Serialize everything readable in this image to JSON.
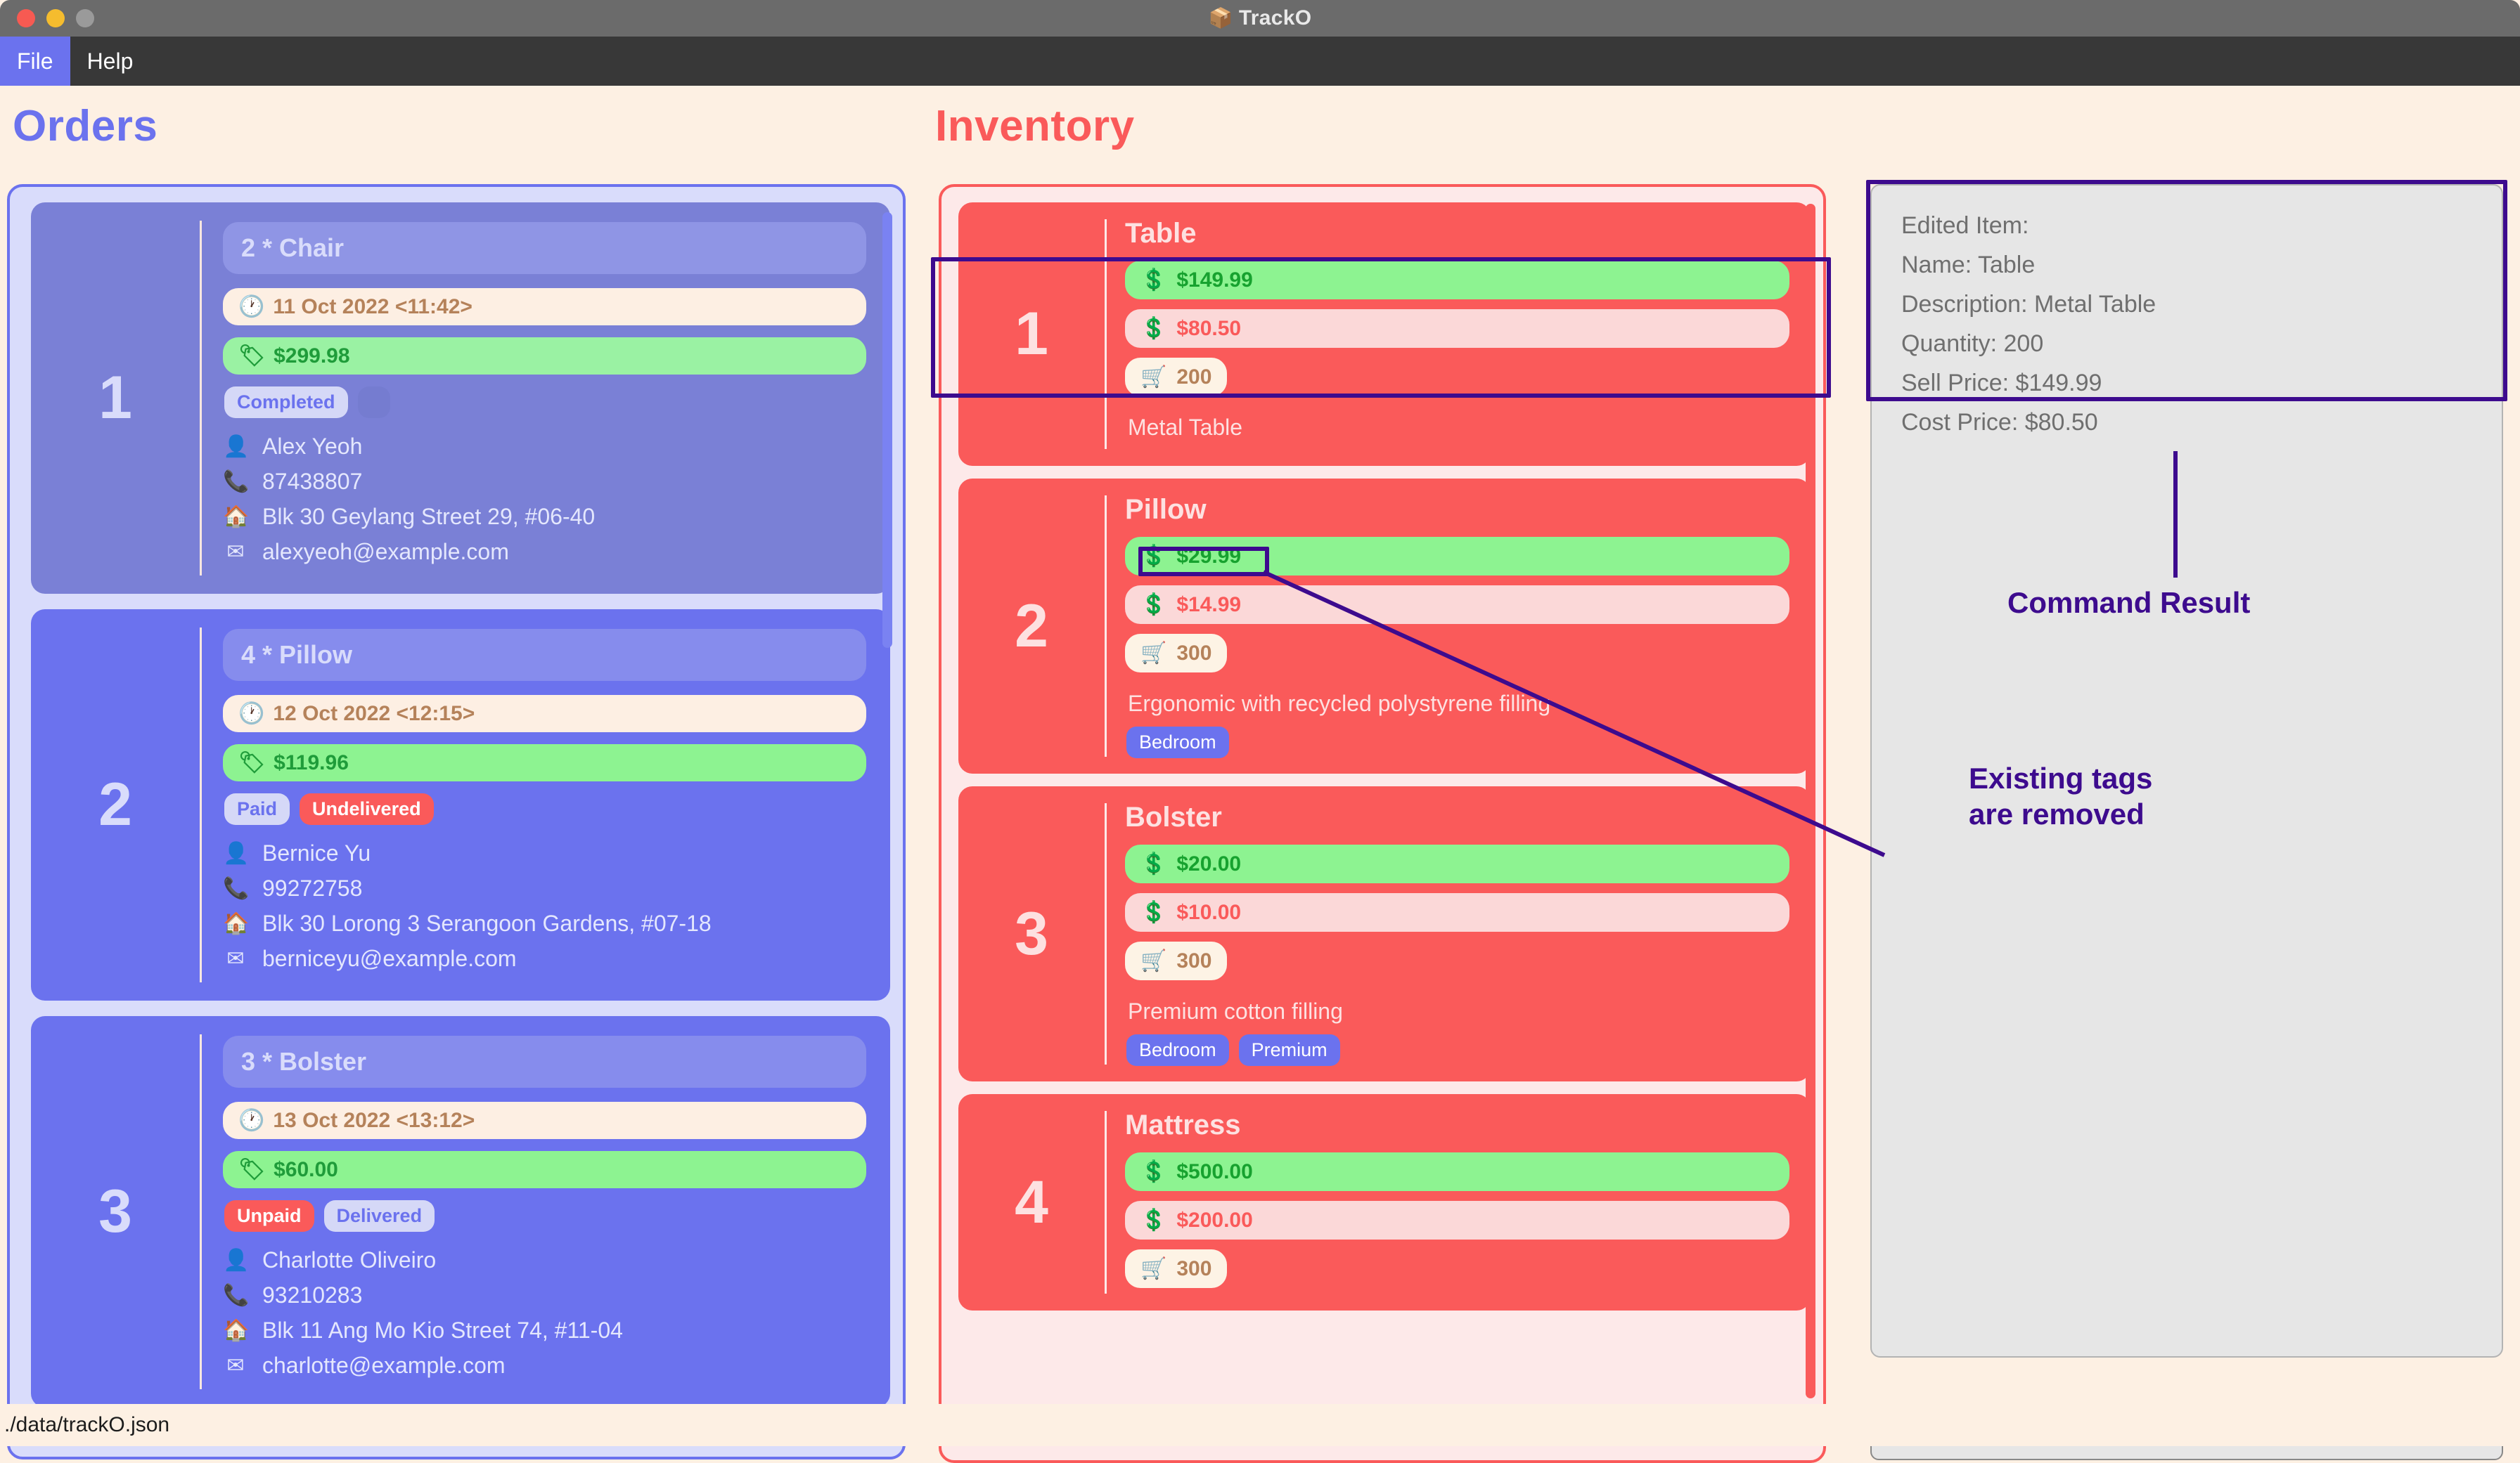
{
  "window": {
    "title": "TrackO",
    "title_icon": "package-icon",
    "traffic_lights": [
      "close",
      "minimize",
      "maximize"
    ]
  },
  "menubar": {
    "items": [
      {
        "label": "File",
        "active": true
      },
      {
        "label": "Help",
        "active": false
      }
    ]
  },
  "orders": {
    "heading": "Orders",
    "accent": "#6b72ee",
    "cards": [
      {
        "index": "1",
        "title": "2 * Chair",
        "date": "11 Oct 2022 <11:42>",
        "price": "$299.98",
        "badges": [
          {
            "label": "Completed",
            "style": "neutral"
          },
          {
            "label": "",
            "style": "ghost"
          }
        ],
        "name": "Alex Yeoh",
        "phone": "87438807",
        "address": "Blk 30 Geylang Street 29, #06-40",
        "email": "alexyeoh@example.com"
      },
      {
        "index": "2",
        "title": "4 * Pillow",
        "date": "12 Oct 2022 <12:15>",
        "price": "$119.96",
        "badges": [
          {
            "label": "Paid",
            "style": "neutral"
          },
          {
            "label": "Undelivered",
            "style": "alert"
          }
        ],
        "name": "Bernice Yu",
        "phone": "99272758",
        "address": "Blk 30 Lorong 3 Serangoon Gardens, #07-18",
        "email": "berniceyu@example.com"
      },
      {
        "index": "3",
        "title": "3 * Bolster",
        "date": "13 Oct 2022 <13:12>",
        "price": "$60.00",
        "badges": [
          {
            "label": "Unpaid",
            "style": "alert"
          },
          {
            "label": "Delivered",
            "style": "neutral"
          }
        ],
        "name": "Charlotte Oliveiro",
        "phone": "93210283",
        "address": "Blk 11 Ang Mo Kio Street 74, #11-04",
        "email": "charlotte@example.com"
      }
    ]
  },
  "inventory": {
    "heading": "Inventory",
    "accent": "#fa5a5a",
    "items": [
      {
        "index": "1",
        "name": "Table",
        "sell_price": "$149.99",
        "cost_price": "$80.50",
        "quantity": "200",
        "description": "Metal Table",
        "tags": []
      },
      {
        "index": "2",
        "name": "Pillow",
        "sell_price": "$29.99",
        "cost_price": "$14.99",
        "quantity": "300",
        "description": "Ergonomic with recycled polystyrene filling",
        "tags": [
          "Bedroom"
        ]
      },
      {
        "index": "3",
        "name": "Bolster",
        "sell_price": "$20.00",
        "cost_price": "$10.00",
        "quantity": "300",
        "description": "Premium cotton filling",
        "tags": [
          "Bedroom",
          "Premium"
        ]
      },
      {
        "index": "4",
        "name": "Mattress",
        "sell_price": "$500.00",
        "cost_price": "$200.00",
        "quantity": "300",
        "description": "",
        "tags": []
      }
    ]
  },
  "result_panel": {
    "lines": [
      "Edited Item:",
      "Name: Table",
      "Description: Metal Table",
      "Quantity: 200",
      "Sell Price: $149.99",
      "Cost Price: $80.50"
    ]
  },
  "command_input": {
    "value": "",
    "placeholder": ""
  },
  "statusbar": {
    "path": "./data/trackO.json"
  },
  "annotations": {
    "color": "#3d0b8e",
    "command_result_label": "Command Result",
    "tags_removed_label_line1": "Existing tags",
    "tags_removed_label_line2": "are removed"
  }
}
